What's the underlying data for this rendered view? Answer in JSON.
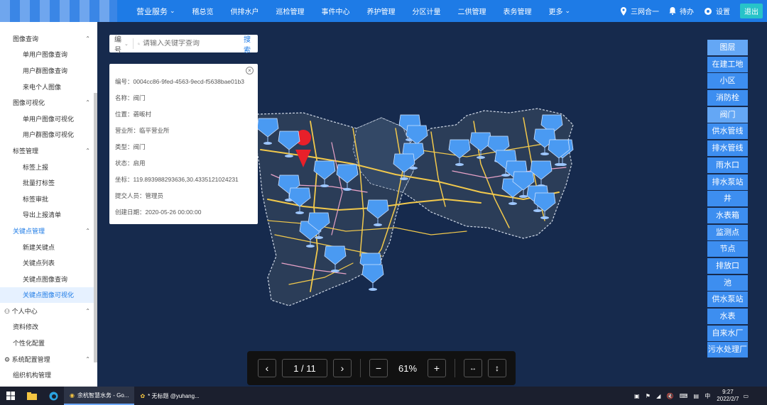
{
  "topnav": {
    "items": [
      {
        "label": "营业服务",
        "icon": "chevron-down-icon",
        "main": true
      },
      {
        "label": "稽总览",
        "icon": "none"
      },
      {
        "label": "供排水户",
        "icon": "user-icon"
      },
      {
        "label": "巡检管理",
        "icon": "circle-icon"
      },
      {
        "label": "事件中心",
        "icon": "broadcast-icon"
      },
      {
        "label": "养护管理",
        "icon": "target-icon"
      },
      {
        "label": "分区计量",
        "icon": "target-icon"
      },
      {
        "label": "二供管理",
        "icon": "target-icon"
      },
      {
        "label": "表务管理",
        "icon": "chart-icon"
      },
      {
        "label": "更多",
        "icon": "chevron-down-icon"
      }
    ],
    "right": {
      "location": "三网合一",
      "pending": "待办",
      "settings": "设置",
      "logout": "退出"
    }
  },
  "sidebar": {
    "items": [
      {
        "label": "图像查询",
        "level": "group",
        "chevron": "up"
      },
      {
        "label": "单用户图像查询",
        "level": "sub"
      },
      {
        "label": "用户群图像查询",
        "level": "sub"
      },
      {
        "label": "来电个人图像",
        "level": "sub"
      },
      {
        "label": "图像可视化",
        "level": "group",
        "chevron": "up"
      },
      {
        "label": "单用户图像可视化",
        "level": "sub"
      },
      {
        "label": "用户群图像可视化",
        "level": "sub"
      },
      {
        "label": "标签管理",
        "level": "group",
        "chevron": "up"
      },
      {
        "label": "标签上报",
        "level": "sub"
      },
      {
        "label": "批量打标签",
        "level": "sub"
      },
      {
        "label": "标签审批",
        "level": "sub"
      },
      {
        "label": "导出上报清单",
        "level": "sub"
      },
      {
        "label": "关键点管理",
        "level": "group-active",
        "chevron": "up"
      },
      {
        "label": "新建关键点",
        "level": "sub"
      },
      {
        "label": "关键点列表",
        "level": "sub"
      },
      {
        "label": "关键点图像查询",
        "level": "sub"
      },
      {
        "label": "关键点图像可视化",
        "level": "active"
      },
      {
        "label": "个人中心",
        "level": "top",
        "chevron": "up"
      },
      {
        "label": "资料修改",
        "level": "group"
      },
      {
        "label": "个性化配置",
        "level": "group"
      },
      {
        "label": "系统配置管理",
        "level": "top",
        "chevron": "up"
      },
      {
        "label": "组织机构管理",
        "level": "group"
      }
    ]
  },
  "search": {
    "select_label": "编号",
    "placeholder": "请输入关键字查询",
    "button": "搜索"
  },
  "info_card": {
    "rows": [
      "编号：0004cc86-9fed-4563-9ecd-f5638bae01b3",
      "名称：阀门",
      "位置：砻畈村",
      "营业所：临平营业所",
      "类型：阀门",
      "状态：启用",
      "坐标：119.893988293636,30.4335121024231",
      "提交人员：管理员",
      "创建日期：2020-05-26 00:00:00"
    ]
  },
  "layers": {
    "title": "图层",
    "items": [
      "在建工地",
      "小区",
      "消防栓",
      "阀门",
      "供水管线",
      "排水管线",
      "雨水口",
      "排水泵站",
      "井",
      "水表箱",
      "监测点",
      "节点",
      "排放口",
      "池",
      "供水泵站",
      "水表",
      "自来水厂",
      "污水处理厂"
    ],
    "selected": "阀门"
  },
  "pager": {
    "page": "1 / 11",
    "zoom": "61%"
  },
  "taskbar": {
    "apps": [
      {
        "label": "余杭智慧水务 - Go...",
        "active": true
      },
      {
        "label": "* 无标题 @yuhang...",
        "active": false
      }
    ],
    "time": "9:27",
    "date": "2022/2/7"
  },
  "colors": {
    "accent": "#1e7be6",
    "marker": "#3d8ef0",
    "pin": "#e8202a"
  }
}
